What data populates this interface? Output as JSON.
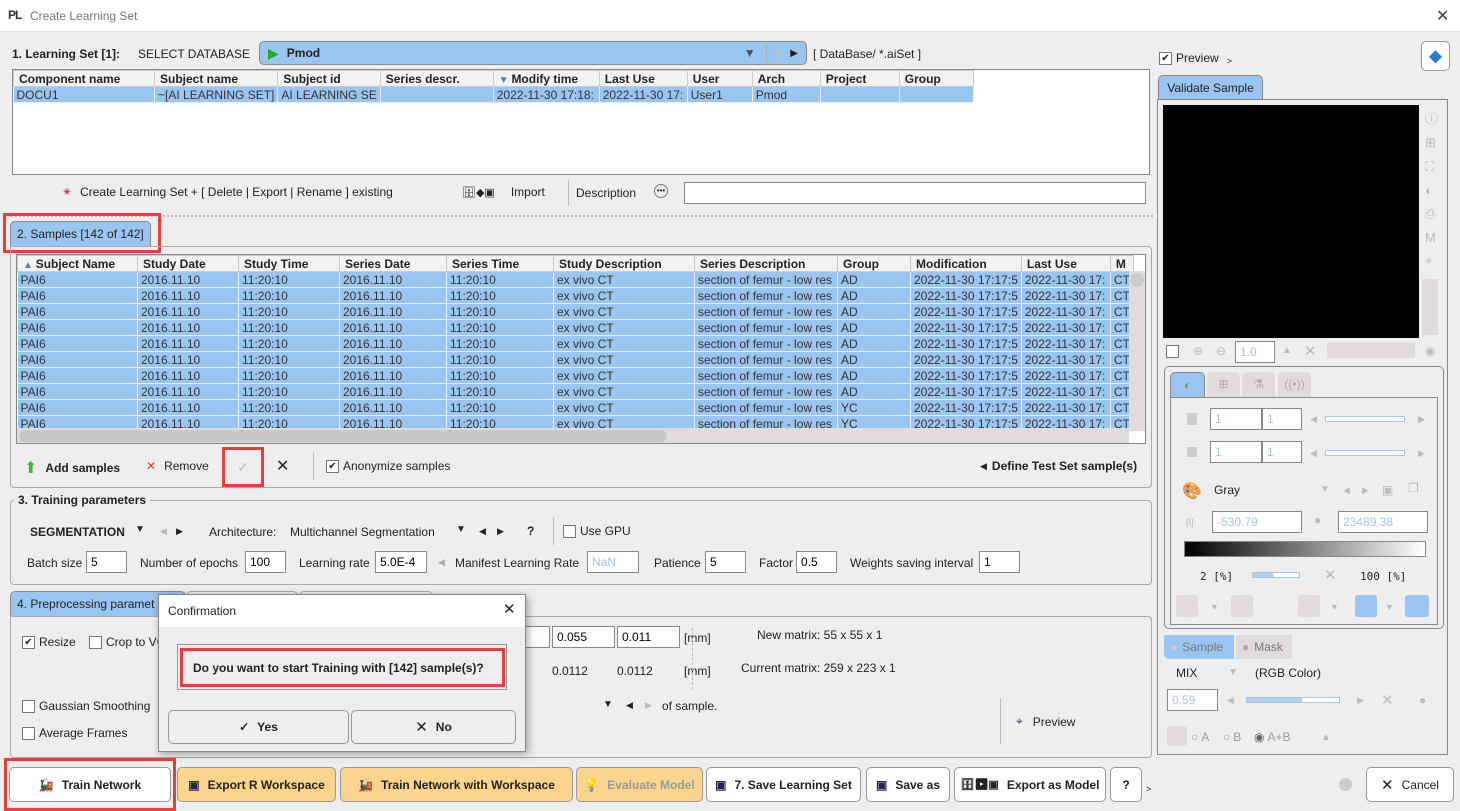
{
  "window": {
    "title": "Create Learning Set",
    "logo": "PL"
  },
  "section1": {
    "label": "1. Learning Set [1]:",
    "select_db_label": "SELECT DATABASE",
    "database": "Pmod",
    "db_path": "[ DataBase/ *.aiSet ]",
    "columns": [
      "Component name",
      "Subject name",
      "Subject id",
      "Series descr.",
      "Modify time",
      "Last Use",
      "User",
      "Arch",
      "Project",
      "Group"
    ],
    "rows": [
      [
        "DOCU1",
        "~[AI LEARNING SET]",
        "AI LEARNING SE",
        "",
        "2022-11-30 17:18:",
        "2022-11-30 17:",
        "User1",
        "Pmod",
        "",
        ""
      ]
    ],
    "create_label": "Create Learning Set + [ Delete | Export | Rename ] existing",
    "import_label": "Import",
    "description_label": "Description",
    "description_value": ""
  },
  "section2": {
    "tab_label": "2. Samples  [142 of 142]",
    "columns": [
      "Subject Name",
      "Study Date",
      "Study Time",
      "Series Date",
      "Series Time",
      "Study Description",
      "Series Description",
      "Group",
      "Modification",
      "Last Use",
      "M"
    ],
    "rows": [
      [
        "PAI6",
        "2016.11.10",
        "11:20:10",
        "2016.11.10",
        "11:20:10",
        "ex vivo CT",
        "section of femur - low res",
        "AD",
        "2022-11-30 17:17:5",
        "2022-11-30 17:",
        "CT"
      ],
      [
        "PAI6",
        "2016.11.10",
        "11:20:10",
        "2016.11.10",
        "11:20:10",
        "ex vivo CT",
        "section of femur - low res",
        "AD",
        "2022-11-30 17:17:5",
        "2022-11-30 17:",
        "CT"
      ],
      [
        "PAI6",
        "2016.11.10",
        "11:20:10",
        "2016.11.10",
        "11:20:10",
        "ex vivo CT",
        "section of femur - low res",
        "AD",
        "2022-11-30 17:17:5",
        "2022-11-30 17:",
        "CT"
      ],
      [
        "PAI6",
        "2016.11.10",
        "11:20:10",
        "2016.11.10",
        "11:20:10",
        "ex vivo CT",
        "section of femur - low res",
        "AD",
        "2022-11-30 17:17:5",
        "2022-11-30 17:",
        "CT"
      ],
      [
        "PAI6",
        "2016.11.10",
        "11:20:10",
        "2016.11.10",
        "11:20:10",
        "ex vivo CT",
        "section of femur - low res",
        "AD",
        "2022-11-30 17:17:5",
        "2022-11-30 17:",
        "CT"
      ],
      [
        "PAI6",
        "2016.11.10",
        "11:20:10",
        "2016.11.10",
        "11:20:10",
        "ex vivo CT",
        "section of femur - low res",
        "AD",
        "2022-11-30 17:17:5",
        "2022-11-30 17:",
        "CT"
      ],
      [
        "PAI6",
        "2016.11.10",
        "11:20:10",
        "2016.11.10",
        "11:20:10",
        "ex vivo CT",
        "section of femur - low res",
        "AD",
        "2022-11-30 17:17:5",
        "2022-11-30 17:",
        "CT"
      ],
      [
        "PAI6",
        "2016.11.10",
        "11:20:10",
        "2016.11.10",
        "11:20:10",
        "ex vivo CT",
        "section of femur - low res",
        "AD",
        "2022-11-30 17:17:5",
        "2022-11-30 17:",
        "CT"
      ],
      [
        "PAI6",
        "2016.11.10",
        "11:20:10",
        "2016.11.10",
        "11:20:10",
        "ex vivo CT",
        "section of femur - low res",
        "YC",
        "2022-11-30 17:17:5",
        "2022-11-30 17:",
        "CT"
      ],
      [
        "PAI6",
        "2016.11.10",
        "11:20:10",
        "2016.11.10",
        "11:20:10",
        "ex vivo CT",
        "section of femur - low res",
        "YC",
        "2022-11-30 17:17:5",
        "2022-11-30 17:",
        "CT"
      ]
    ],
    "add_samples": "Add samples",
    "remove": "Remove",
    "anonymize": "Anonymize samples",
    "anonymize_checked": true,
    "define_test": "Define Test Set sample(s)"
  },
  "section3": {
    "legend": "3. Training parameters",
    "mode": "SEGMENTATION",
    "architecture_label": "Architecture:",
    "architecture": "Multichannel Segmentation",
    "help": "?",
    "use_gpu": "Use GPU",
    "batch_size_label": "Batch size",
    "batch_size": "5",
    "epochs_label": "Number of epochs",
    "epochs": "100",
    "lr_label": "Learning rate",
    "lr": "5.0E-4",
    "manifest_label": "Manifest Learning Rate",
    "manifest": "NaN",
    "patience_label": "Patience",
    "patience": "5",
    "factor_label": "Factor",
    "factor": "0.5",
    "weights_label": "Weights saving interval",
    "weights": "1"
  },
  "section4": {
    "tab_label": "4. Preprocessing paramet",
    "resize": "Resize",
    "crop": "Crop to VO",
    "gaussian": "Gaussian Smoothing",
    "average": "Average Frames",
    "new_pix_y": "0.055",
    "new_pix_z": "0.011",
    "mm": "[mm]",
    "cur_pix_y": "0.0112",
    "cur_pix_z": "0.0112",
    "new_matrix": "New matrix:  55  x  55  x 1",
    "current_matrix": "Current matrix: 259 x 223 x 1",
    "of_sample": "of sample.",
    "preview": "Preview"
  },
  "dialog": {
    "title": "Confirmation",
    "message": "Do you want to start Training with [142] sample(s)?",
    "yes": "Yes",
    "no": "No"
  },
  "bottom": {
    "train": "Train Network",
    "export_r": "Export R Workspace",
    "train_ws": "Train Network with Workspace",
    "evaluate": "Evaluate Model",
    "save": "7. Save Learning Set",
    "save_as": "Save as",
    "export_model": "Export as Model",
    "help": "?",
    "cancel": "Cancel"
  },
  "right": {
    "preview_label": "Preview",
    "tab": "Validate Sample",
    "zoom": "1.0",
    "frame1a": "1",
    "frame1b": "1",
    "frame2a": "1",
    "frame2b": "1",
    "colormap": "Gray",
    "min": "-530.79",
    "max": "23489.38",
    "lower_pct": "2  [%]",
    "upper_pct": "100  [%]",
    "sample_tab": "Sample",
    "mask_tab": "Mask",
    "mix": "MIX",
    "rgb": "(RGB Color)",
    "opacity": "0.59",
    "radio_a": "A",
    "radio_b": "B",
    "radio_ab": "A+B"
  }
}
